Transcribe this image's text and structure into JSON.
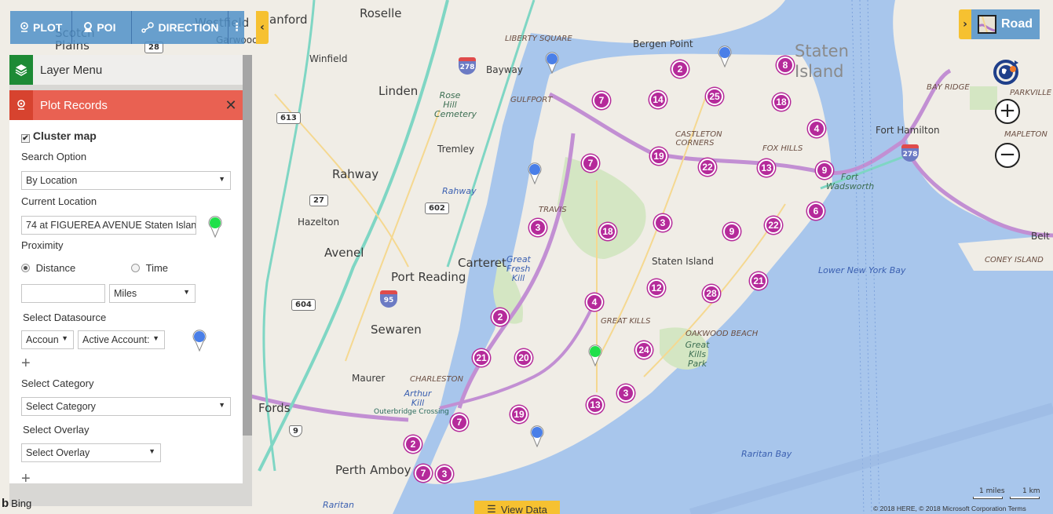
{
  "toolbar": {
    "plot_label": "PLOT",
    "poi_label": "POI",
    "direction_label": "DIRECTION",
    "more_icon": "⋮",
    "collapse_icon": "‹"
  },
  "layer_menu": {
    "title": "Layer Menu",
    "icon": "layers-icon"
  },
  "plot_records": {
    "title": "Plot Records",
    "close_icon": "✕",
    "cluster_map_label": "Cluster map",
    "cluster_map_checked": true,
    "search_option_label": "Search Option",
    "search_option_value": "By Location",
    "current_location_label": "Current Location",
    "current_location_value": "74 at FIGUEREA AVENUE Staten Islan",
    "current_location_pin_color": "#1fe04a",
    "proximity_label": "Proximity",
    "proximity_distance_label": "Distance",
    "proximity_time_label": "Time",
    "proximity_selected": "Distance",
    "distance_value": "",
    "unit_value": "Miles",
    "select_datasource_label": "Select Datasource",
    "datasource_entity_value": "Accoun",
    "datasource_view_value": "Active Account:",
    "datasource_pin_color": "#4a7fe8",
    "add_icon": "+",
    "select_category_label": "Select Category",
    "select_category_value": "Select Category",
    "select_overlay_label": "Select Overlay",
    "select_overlay_value": "Select Overlay"
  },
  "map_type": {
    "label": "Road",
    "collapse_icon": "›"
  },
  "zoom_controls": {
    "zoom_in": "+",
    "zoom_out": "−"
  },
  "view_data": {
    "label": "View Data"
  },
  "bing_label": "Bing",
  "scale": {
    "miles": "1 miles",
    "km": "1 km"
  },
  "copyright": "© 2018 HERE, © 2018 Microsoft Corporation  Terms",
  "colors": {
    "cluster": "#b52a9a",
    "toolbar": "#5091c8",
    "accent_yellow": "#f6c131",
    "plot_header": "#e96152",
    "layer_icon_bg": "#1d8a35",
    "water": "#a8c6ec",
    "land": "#f0ede6"
  },
  "map_labels": [
    {
      "text": "anford",
      "cls": "city"
    },
    {
      "text": "Roselle",
      "cls": "city"
    },
    {
      "text": "Scotch Plains",
      "cls": "city"
    },
    {
      "text": "Westfield",
      "cls": "city"
    },
    {
      "text": "Garwood",
      "cls": "town"
    },
    {
      "text": "Winfield",
      "cls": "town"
    },
    {
      "text": "Linden",
      "cls": "city"
    },
    {
      "text": "Bayway",
      "cls": "town"
    },
    {
      "text": "LIBERTY SQUARE",
      "cls": "hood"
    },
    {
      "text": "GULFPORT",
      "cls": "hood"
    },
    {
      "text": "Rose Hill Cemetery",
      "cls": "park-lbl"
    },
    {
      "text": "Tremley",
      "cls": "town"
    },
    {
      "text": "Rahway",
      "cls": "city"
    },
    {
      "text": "Rahway",
      "cls": "water-lbl"
    },
    {
      "text": "Hazelton",
      "cls": "town"
    },
    {
      "text": "Avenel",
      "cls": "city"
    },
    {
      "text": "Carteret",
      "cls": "city"
    },
    {
      "text": "Port Reading",
      "cls": "city"
    },
    {
      "text": "Great Fresh Kill",
      "cls": "water-lbl"
    },
    {
      "text": "Sewaren",
      "cls": "city"
    },
    {
      "text": "TRAVIS",
      "cls": "hood"
    },
    {
      "text": "Maurer",
      "cls": "town"
    },
    {
      "text": "CHARLESTON",
      "cls": "hood"
    },
    {
      "text": "Arthur Kill",
      "cls": "water-lbl"
    },
    {
      "text": "Fords",
      "cls": "city"
    },
    {
      "text": "Perth Amboy",
      "cls": "city"
    },
    {
      "text": "Raritan",
      "cls": "water-lbl"
    },
    {
      "text": "Bergen Point",
      "cls": "town"
    },
    {
      "text": "Staten Island",
      "cls": "big"
    },
    {
      "text": "CASTLETON CORNERS",
      "cls": "hood"
    },
    {
      "text": "FOX HILLS",
      "cls": "hood"
    },
    {
      "text": "Fort Wadsworth",
      "cls": "park-lbl"
    },
    {
      "text": "Fort Hamilton",
      "cls": "town"
    },
    {
      "text": "BAY RIDGE",
      "cls": "hood"
    },
    {
      "text": "PARKVILLE",
      "cls": "hood"
    },
    {
      "text": "MAPLETON",
      "cls": "hood"
    },
    {
      "text": "CONEY ISLAND",
      "cls": "hood"
    },
    {
      "text": "Lower New York Bay",
      "cls": "water-lbl"
    },
    {
      "text": "Staten Island",
      "cls": "town"
    },
    {
      "text": "GREAT KILLS",
      "cls": "hood"
    },
    {
      "text": "OAKWOOD BEACH",
      "cls": "hood"
    },
    {
      "text": "Great Kills Park",
      "cls": "park-lbl"
    },
    {
      "text": "Raritan Bay",
      "cls": "water-lbl"
    },
    {
      "text": "Belt Pkwy",
      "cls": "town"
    },
    {
      "text": "Outerbridge Crossing",
      "cls": "town"
    }
  ],
  "road_shields": [
    {
      "text": "28",
      "type": "county"
    },
    {
      "text": "613",
      "type": "county"
    },
    {
      "text": "27",
      "type": "county"
    },
    {
      "text": "602",
      "type": "county"
    },
    {
      "text": "604",
      "type": "county"
    },
    {
      "text": "9",
      "type": "us"
    },
    {
      "text": "278",
      "type": "interstate"
    },
    {
      "text": "95",
      "type": "interstate"
    },
    {
      "text": "278",
      "type": "interstate"
    }
  ],
  "clusters": [
    {
      "count": "2"
    },
    {
      "count": "8"
    },
    {
      "count": "7"
    },
    {
      "count": "14"
    },
    {
      "count": "25"
    },
    {
      "count": "18"
    },
    {
      "count": "4"
    },
    {
      "count": "7"
    },
    {
      "count": "19"
    },
    {
      "count": "22"
    },
    {
      "count": "13"
    },
    {
      "count": "9"
    },
    {
      "count": "3"
    },
    {
      "count": "18"
    },
    {
      "count": "3"
    },
    {
      "count": "9"
    },
    {
      "count": "22"
    },
    {
      "count": "6"
    },
    {
      "count": "12"
    },
    {
      "count": "28"
    },
    {
      "count": "21"
    },
    {
      "count": "4"
    },
    {
      "count": "2"
    },
    {
      "count": "21"
    },
    {
      "count": "20"
    },
    {
      "count": "24"
    },
    {
      "count": "3"
    },
    {
      "count": "13"
    },
    {
      "count": "19"
    },
    {
      "count": "7"
    },
    {
      "count": "2"
    },
    {
      "count": "7"
    },
    {
      "count": "3"
    }
  ],
  "pins": [
    {
      "type": "record",
      "color": "#4a7fe8"
    },
    {
      "type": "record",
      "color": "#4a7fe8"
    },
    {
      "type": "record",
      "color": "#4a7fe8"
    },
    {
      "type": "record",
      "color": "#4a7fe8"
    },
    {
      "type": "current-location",
      "color": "#1fe04a"
    }
  ]
}
